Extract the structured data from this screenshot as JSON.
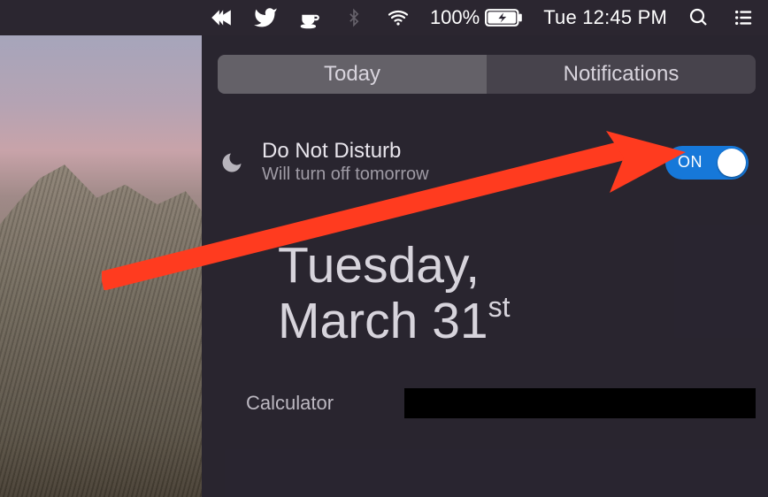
{
  "menubar": {
    "battery_percent": "100%",
    "clock": "Tue 12:45 PM"
  },
  "tabs": {
    "today": "Today",
    "notifications": "Notifications",
    "active": "Today"
  },
  "dnd": {
    "title": "Do Not Disturb",
    "subtitle": "Will turn off tomorrow",
    "switch_label": "ON",
    "switch_on": true
  },
  "date": {
    "line1": "Tuesday,",
    "line2_month": "March 31",
    "line2_ordinal": "st"
  },
  "widgets": {
    "calculator_label": "Calculator"
  },
  "annotation": {
    "arrow_color": "#ff3b1f"
  }
}
